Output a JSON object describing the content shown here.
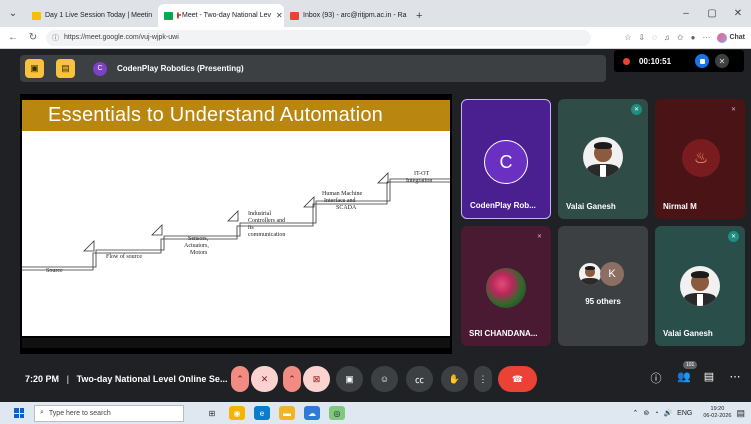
{
  "browser": {
    "tabs": [
      {
        "title": "Day 1 Live Session Today | Meetin",
        "active": false
      },
      {
        "title": "Meet - Two-day National Lev",
        "active": true
      },
      {
        "title": "Inbox (93) - arc@ritjpm.ac.in - Ra",
        "active": false
      }
    ],
    "url": "https://meet.google.com/vuj-wjpk-uwi",
    "chat_label": "Chat"
  },
  "meeting": {
    "presenter_label": "CodenPlay Robotics (Presenting)",
    "presenter_initial": "C",
    "recording_time": "00:10:51",
    "time": "7:20 PM",
    "title": "Two-day National Level Online Se...",
    "participant_count": "101"
  },
  "slide": {
    "title": "Essentials to Understand Automation",
    "steps": [
      [
        "Source"
      ],
      [
        "Flow of source"
      ],
      [
        "Sensors,",
        "Actuators,",
        "Motors"
      ],
      [
        "Industrial",
        "Controllers and",
        "its",
        "communication"
      ],
      [
        "Human Machine",
        "Interface and",
        "SCADA"
      ],
      [
        "IT-OT",
        "Integration"
      ]
    ]
  },
  "participants": [
    {
      "name": "CodenPlay Rob...",
      "initial": "C",
      "type": "initial",
      "bg": "#4a1f8f"
    },
    {
      "name": "Valai Ganesh",
      "type": "photo",
      "bg": "#2f4c46"
    },
    {
      "name": "Nirmal M",
      "type": "logo",
      "bg": "#4a1416"
    },
    {
      "name": "SRI CHANDANA...",
      "type": "flower",
      "bg": "#4a1a32"
    },
    {
      "others": "95 others",
      "initial": "K",
      "type": "others",
      "bg": "#3c4043"
    },
    {
      "name": "Valai Ganesh",
      "type": "photo",
      "bg": "#2a4f4a"
    }
  ],
  "taskbar": {
    "search_placeholder": "Type here to search",
    "lang": "ENG",
    "clock_time": "19:20",
    "clock_date": "06-02-2026"
  }
}
